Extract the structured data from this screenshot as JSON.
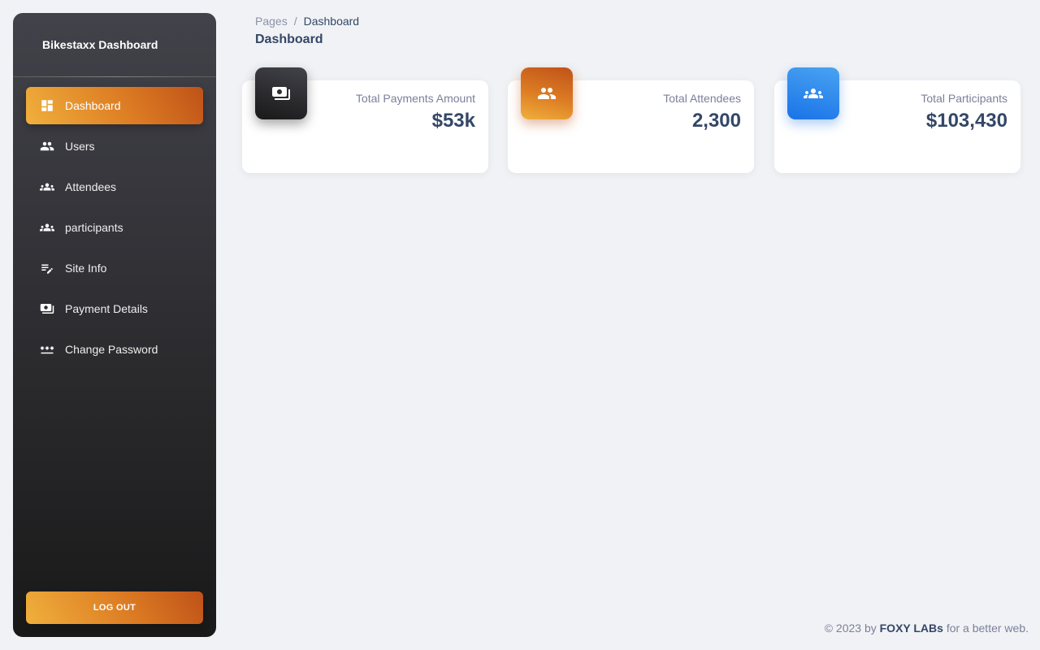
{
  "sidebar": {
    "brand": "Bikestaxx Dashboard",
    "items": [
      {
        "label": "Dashboard",
        "icon": "dashboard-icon",
        "active": true
      },
      {
        "label": "Users",
        "icon": "people-icon"
      },
      {
        "label": "Attendees",
        "icon": "groups-icon"
      },
      {
        "label": "participants",
        "icon": "groups-icon"
      },
      {
        "label": "Site Info",
        "icon": "edit-note-icon"
      },
      {
        "label": "Payment Details",
        "icon": "payments-icon"
      },
      {
        "label": "Change Password",
        "icon": "password-icon"
      }
    ],
    "logout_label": "LOG OUT"
  },
  "header": {
    "breadcrumb_root": "Pages",
    "breadcrumb_separator": "/",
    "breadcrumb_current": "Dashboard",
    "title": "Dashboard"
  },
  "cards": [
    {
      "label": "Total Payments Amount",
      "value": "$53k",
      "icon": "payments-icon",
      "color": "#191919"
    },
    {
      "label": "Total Attendees",
      "value": "2,300",
      "icon": "people-icon",
      "color": "#dd7d24"
    },
    {
      "label": "Total Participants",
      "value": "$103,430",
      "icon": "groups-icon",
      "color": "#1a73e8"
    }
  ],
  "footer": {
    "prefix": "© 2023 by",
    "brand": "FOXY LABs",
    "suffix": "for a better web."
  },
  "colors": {
    "accent_orange": "#dd7d24",
    "sidebar_dark": "#42424a",
    "text_primary": "#344767"
  }
}
